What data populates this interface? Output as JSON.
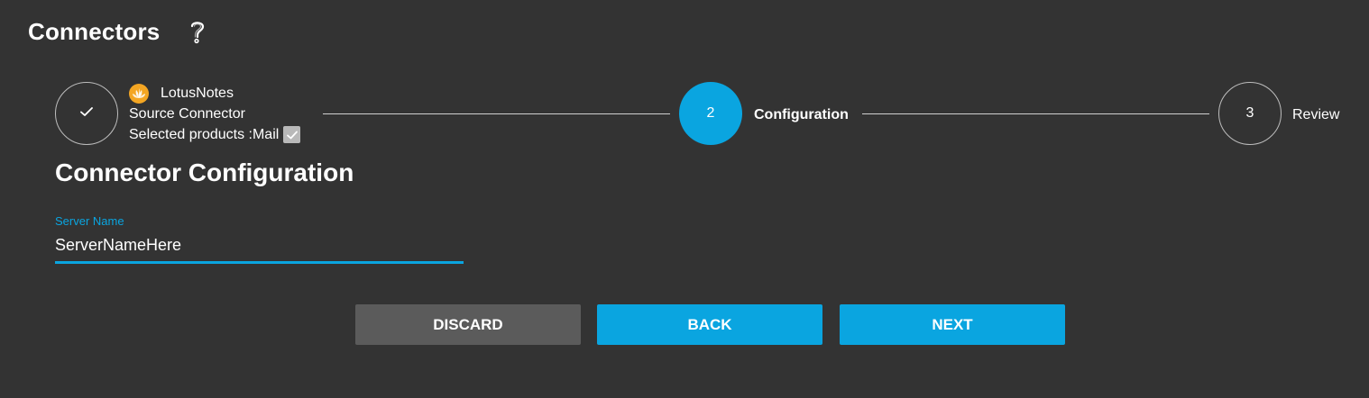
{
  "header": {
    "title": "Connectors",
    "help_icon": "question-mark-icon"
  },
  "stepper": {
    "step1": {
      "status": "completed",
      "icon": "checkmark-icon",
      "connector_name": "LotusNotes",
      "connector_logo": "lotus-notes-logo-icon",
      "connector_type": "Source Connector",
      "products_label": "Selected products :Mail",
      "products_checked": true
    },
    "step2": {
      "number": "2",
      "label": "Configuration",
      "status": "active"
    },
    "step3": {
      "number": "3",
      "label": "Review",
      "status": "pending"
    }
  },
  "section": {
    "title": "Connector Configuration"
  },
  "form": {
    "server_name": {
      "label": "Server Name",
      "value": "ServerNameHere"
    }
  },
  "buttons": {
    "discard": "DISCARD",
    "back": "BACK",
    "next": "NEXT"
  },
  "colors": {
    "background": "#333333",
    "accent": "#0aa5e0",
    "discard_button": "#5b5b5b",
    "logo": "#f4a623"
  }
}
